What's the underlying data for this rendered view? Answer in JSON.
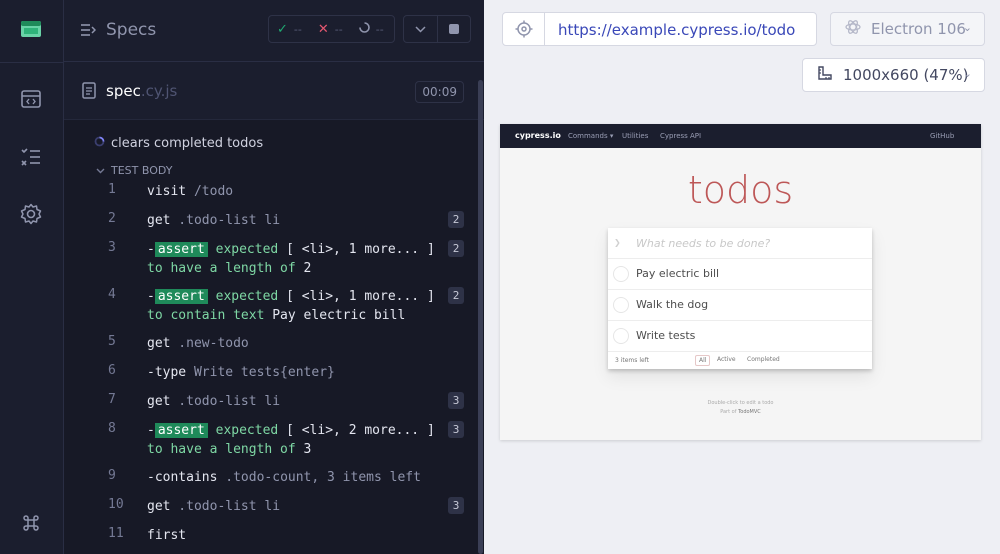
{
  "header": {
    "title": "Specs",
    "passed": "--",
    "failed": "--",
    "pending": "--"
  },
  "spec": {
    "name": "spec",
    "ext": ".cy.js",
    "duration": "00:09"
  },
  "test": {
    "title": "clears completed todos",
    "body_label": "TEST BODY"
  },
  "commands": [
    {
      "num": "1",
      "lines": [
        [
          {
            "t": "name",
            "v": "visit"
          },
          {
            "t": "arg",
            "v": " /todo"
          }
        ]
      ],
      "badge": ""
    },
    {
      "num": "2",
      "lines": [
        [
          {
            "t": "name",
            "v": "get"
          },
          {
            "t": "arg",
            "v": " .todo-list li"
          }
        ]
      ],
      "badge": "2"
    },
    {
      "num": "3",
      "lines": [
        [
          {
            "t": "name",
            "v": "-"
          },
          {
            "t": "assert",
            "v": "assert"
          },
          {
            "t": "expect",
            "v": " expected "
          },
          {
            "t": "val",
            "v": "[ <li>, 1 more... ]"
          }
        ],
        [
          {
            "t": "expect",
            "v": "to have a length of "
          },
          {
            "t": "val",
            "v": "2"
          }
        ]
      ],
      "badge": "2"
    },
    {
      "num": "4",
      "lines": [
        [
          {
            "t": "name",
            "v": "-"
          },
          {
            "t": "assert",
            "v": "assert"
          },
          {
            "t": "expect",
            "v": " expected "
          },
          {
            "t": "val",
            "v": "[ <li>, 1 more... ]"
          }
        ],
        [
          {
            "t": "expect",
            "v": "to contain text "
          },
          {
            "t": "val",
            "v": "Pay electric bill"
          }
        ]
      ],
      "badge": "2"
    },
    {
      "num": "5",
      "lines": [
        [
          {
            "t": "name",
            "v": "get"
          },
          {
            "t": "arg",
            "v": " .new-todo"
          }
        ]
      ],
      "badge": ""
    },
    {
      "num": "6",
      "lines": [
        [
          {
            "t": "name",
            "v": "-type"
          },
          {
            "t": "arg",
            "v": " Write tests{enter}"
          }
        ]
      ],
      "badge": ""
    },
    {
      "num": "7",
      "lines": [
        [
          {
            "t": "name",
            "v": "get"
          },
          {
            "t": "arg",
            "v": " .todo-list li"
          }
        ]
      ],
      "badge": "3"
    },
    {
      "num": "8",
      "lines": [
        [
          {
            "t": "name",
            "v": "-"
          },
          {
            "t": "assert",
            "v": "assert"
          },
          {
            "t": "expect",
            "v": " expected "
          },
          {
            "t": "val",
            "v": "[ <li>, 2 more... ]"
          }
        ],
        [
          {
            "t": "expect",
            "v": "to have a length of "
          },
          {
            "t": "val",
            "v": "3"
          }
        ]
      ],
      "badge": "3"
    },
    {
      "num": "9",
      "lines": [
        [
          {
            "t": "name",
            "v": "-contains"
          },
          {
            "t": "arg",
            "v": " .todo-count, 3 items left"
          }
        ]
      ],
      "badge": ""
    },
    {
      "num": "10",
      "lines": [
        [
          {
            "t": "name",
            "v": "get"
          },
          {
            "t": "arg",
            "v": " .todo-list li"
          }
        ]
      ],
      "badge": "3"
    },
    {
      "num": "11",
      "lines": [
        [
          {
            "t": "name",
            "v": "first"
          }
        ]
      ],
      "badge": ""
    }
  ],
  "browser": {
    "url": "https://example.cypress.io/todo",
    "engine": "Electron 106",
    "viewport": "1000x660 (47%)"
  },
  "aut": {
    "brand": "cypress.io",
    "nav": [
      "Commands ▾",
      "Utilities",
      "Cypress API"
    ],
    "github": "GitHub",
    "heading": "todos",
    "placeholder": "What needs to be done?",
    "todos": [
      "Pay electric bill",
      "Walk the dog",
      "Write tests"
    ],
    "count": "3 items left",
    "filters": [
      "All",
      "Active",
      "Completed"
    ],
    "footer_hint": "Double-click to edit a todo",
    "footer_credit_prefix": "Part of",
    "footer_credit_link": "TodoMVC"
  },
  "colors": {
    "accent_green": "#1f8a5a",
    "expect_green": "#7ed7a4",
    "url_blue": "#3a48b8",
    "todos_red": "#af2f2f"
  }
}
